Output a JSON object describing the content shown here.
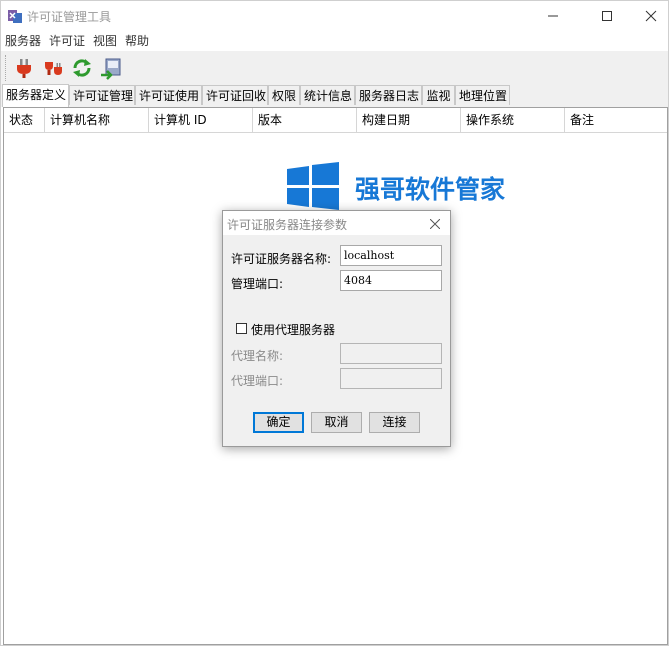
{
  "window": {
    "title": "许可证管理工具"
  },
  "menu": [
    "服务器",
    "许可证",
    "视图",
    "帮助"
  ],
  "toolbar": [
    {
      "icon": "plug-connect-icon"
    },
    {
      "icon": "plug-disconnect-icon"
    },
    {
      "icon": "refresh-icon"
    },
    {
      "icon": "export-icon"
    }
  ],
  "tabs": [
    "服务器定义",
    "许可证管理",
    "许可证使用",
    "许可证回收",
    "权限",
    "统计信息",
    "服务器日志",
    "监视",
    "地理位置"
  ],
  "table": {
    "columns": [
      "状态",
      "计算机名称",
      "计算机 ID",
      "版本",
      "构建日期",
      "操作系统",
      "备注"
    ]
  },
  "watermark": {
    "text": "强哥软件管家"
  },
  "dialog": {
    "title": "许可证服务器连接参数",
    "server_name_label": "许可证服务器名称:",
    "server_name_value": "localhost",
    "port_label": "管理端口:",
    "port_value": "4084",
    "proxy_checkbox_label": "使用代理服务器",
    "proxy_name_label": "代理名称:",
    "proxy_name_value": "",
    "proxy_port_label": "代理端口:",
    "proxy_port_value": "",
    "ok_label": "确定",
    "cancel_label": "取消",
    "connect_label": "连接"
  },
  "colors": {
    "accent": "#1778d6",
    "focus": "#0078d7"
  }
}
